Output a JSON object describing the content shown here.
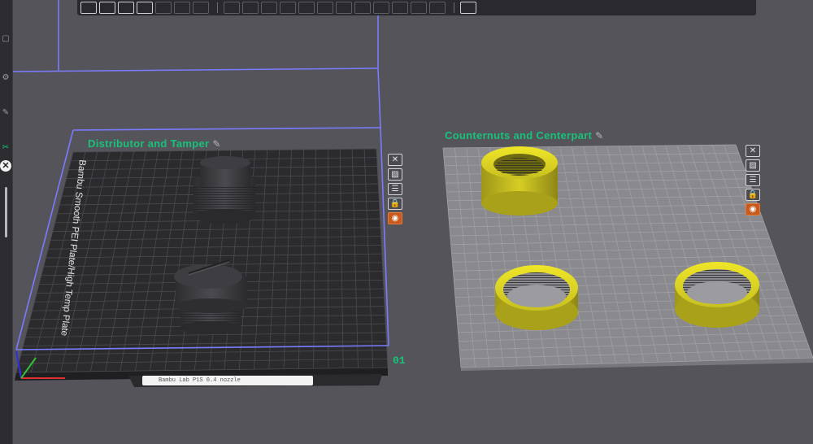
{
  "plates": [
    {
      "label": "Distributor and Tamper",
      "edit_glyph": "✎",
      "number": "01",
      "text": "Bambu Smooth PEI Plate/High Temp Plate"
    },
    {
      "label": "Counternuts and Centerpart",
      "edit_glyph": "✎",
      "number": ""
    }
  ],
  "plate_tools": [
    {
      "icon": "close-icon",
      "glyph": "✕"
    },
    {
      "icon": "image-icon",
      "glyph": "▨"
    },
    {
      "icon": "settings-icon",
      "glyph": "☰"
    },
    {
      "icon": "lock-icon",
      "glyph": "🔒"
    },
    {
      "icon": "slice-icon",
      "glyph": "◉"
    }
  ],
  "bottom_bar": {
    "text": "Bambu Lab P1S 0.4 nozzle"
  },
  "colors": {
    "background": "#54545a",
    "plate_dark": "#2b2b2e",
    "plate_light": "#8a8a8e",
    "grid": "#4a4a50",
    "bounding_box": "#7b7bff",
    "label_green": "#18c27a",
    "yellow_part": "#c8c020",
    "dark_part": "#3a3a3d"
  }
}
